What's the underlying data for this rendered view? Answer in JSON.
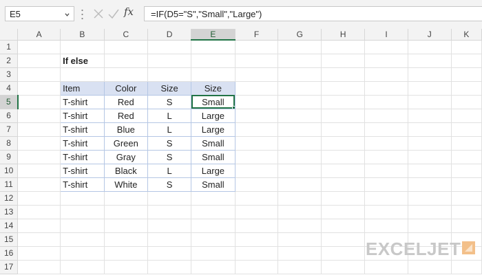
{
  "formula_bar": {
    "name_box": "E5",
    "formula": "=IF(D5=\"S\",\"Small\",\"Large\")",
    "fx_label": "fx"
  },
  "columns": [
    "A",
    "B",
    "C",
    "D",
    "E",
    "F",
    "G",
    "H",
    "I",
    "J",
    "K"
  ],
  "rows": [
    "1",
    "2",
    "3",
    "4",
    "5",
    "6",
    "7",
    "8",
    "9",
    "10",
    "11",
    "12",
    "13",
    "14",
    "15",
    "16",
    "17"
  ],
  "active_cell": {
    "column": "E",
    "row": "5"
  },
  "sheet": {
    "title": "If else",
    "table_headers": [
      "Item",
      "Color",
      "Size",
      "Size"
    ],
    "table_rows": [
      [
        "T-shirt",
        "Red",
        "S",
        "Small"
      ],
      [
        "T-shirt",
        "Red",
        "L",
        "Large"
      ],
      [
        "T-shirt",
        "Blue",
        "L",
        "Large"
      ],
      [
        "T-shirt",
        "Green",
        "S",
        "Small"
      ],
      [
        "T-shirt",
        "Gray",
        "S",
        "Small"
      ],
      [
        "T-shirt",
        "Black",
        "L",
        "Large"
      ],
      [
        "T-shirt",
        "White",
        "S",
        "Small"
      ]
    ]
  },
  "logo": {
    "text": "EXCELJET"
  },
  "colors": {
    "accent": "#217346",
    "table_header_fill": "#d9e1f2",
    "table_border": "#b4c6e4"
  }
}
